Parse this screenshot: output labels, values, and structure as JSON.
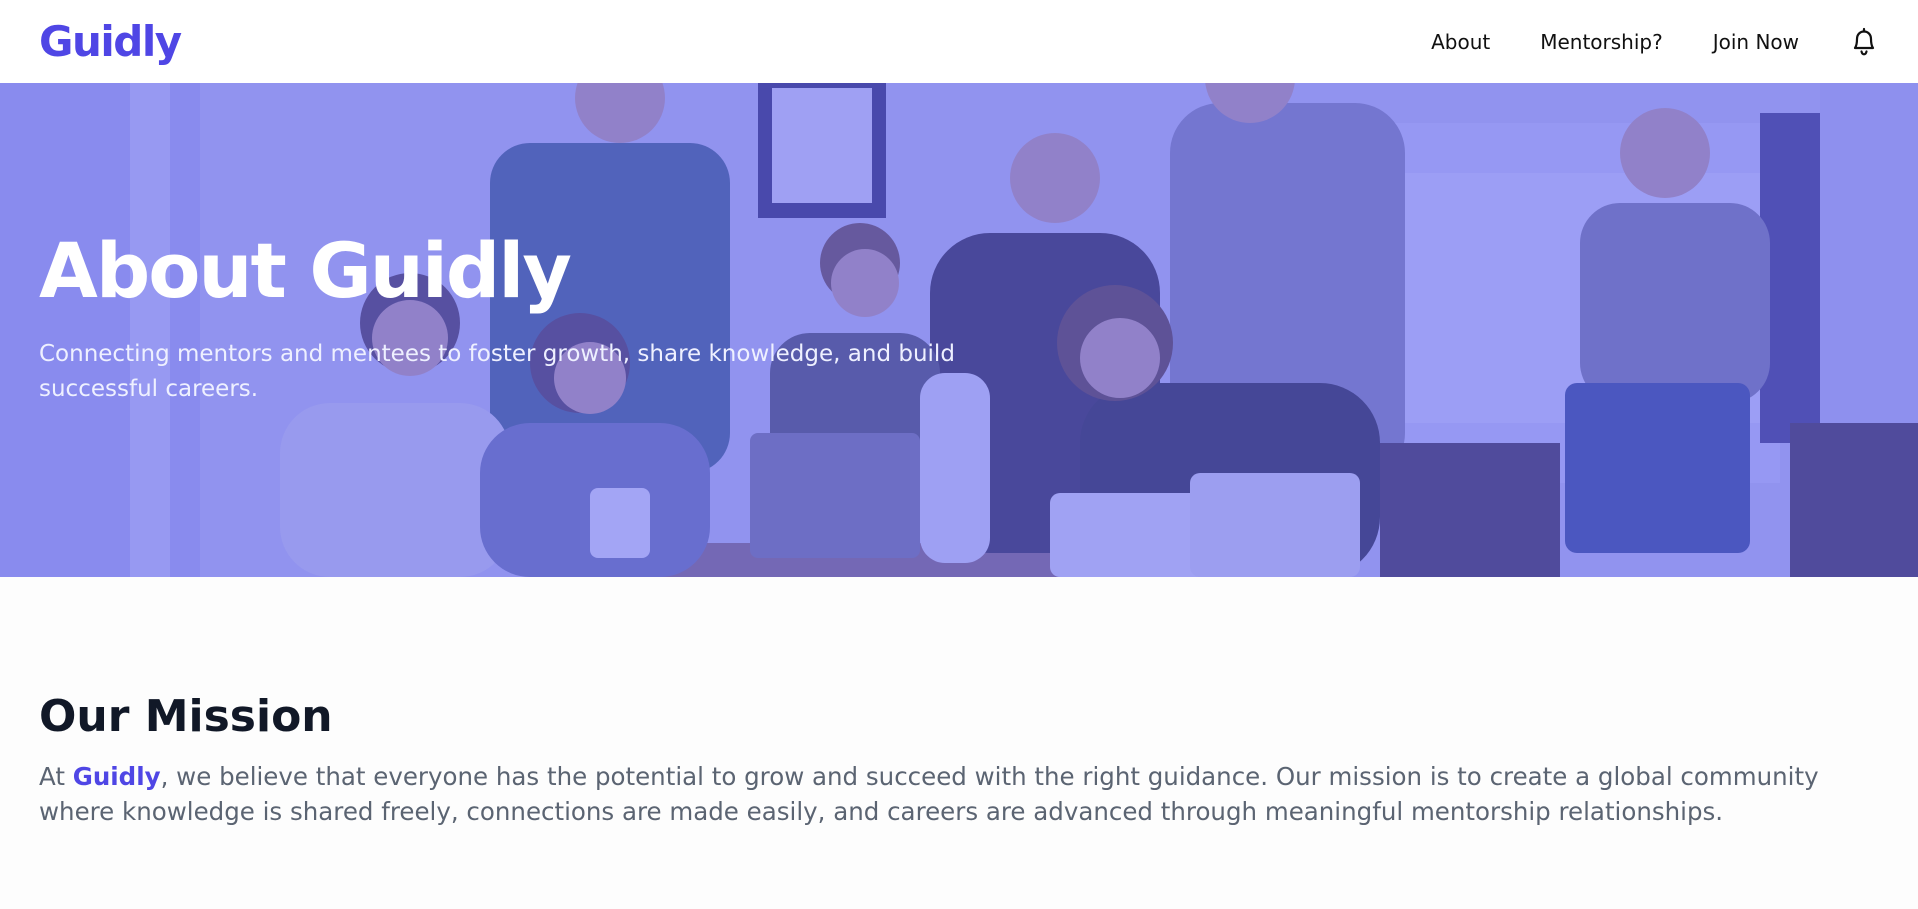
{
  "nav": {
    "logo": "Guidly",
    "links": [
      "About",
      "Mentorship?",
      "Join Now"
    ],
    "bell_icon": "bell-icon"
  },
  "hero": {
    "title": "About Guidly",
    "subtitle": "Connecting mentors and mentees to foster growth, share knowledge, and build successful careers."
  },
  "mission": {
    "title": "Our Mission",
    "text_prefix": "At ",
    "brand": "Guidly",
    "text_suffix": ", we believe that everyone has the potential to grow and succeed with the right guidance. Our mission is to create a global community where knowledge is shared freely, connections are made easily, and careers are advanced through meaningful mentorship relationships."
  },
  "colors": {
    "brand": "#4f46e5",
    "hero_overlay": "#6366f1",
    "heading": "#111827",
    "body_text": "#5b6472"
  }
}
